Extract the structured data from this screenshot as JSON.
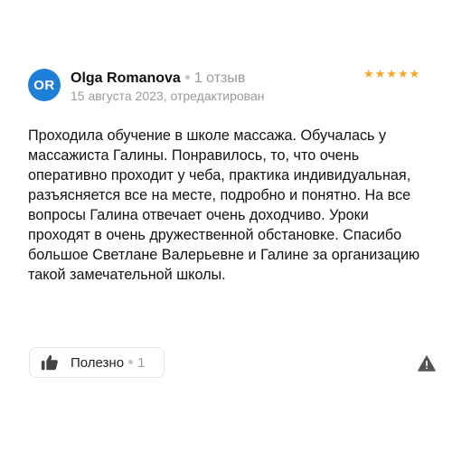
{
  "review": {
    "avatar_initials": "OR",
    "avatar_color": "#1f7fd8",
    "author_name": "Olga Romanova",
    "author_reviews": "1 отзыв",
    "date": "15 августа 2023, отредактирован",
    "rating": 5,
    "star_color": "#f5a623",
    "text": "Проходила обучение в школе массажа. Обучалась у массажиста Галины. Понравилось, то, что очень оперативно проходит у чеба, практика индивидуальная, разъясняется все на месте, подробно и понятно. На все вопросы Галина отвечает очень доходчиво. Уроки проходят в очень дружественной обстановке. Спасибо большое Светлане Валерьевне и Галине за организацию такой замечательной школы."
  },
  "actions": {
    "useful_label": "Полезно",
    "useful_count": "1",
    "thumb_icon": "thumbs-up-icon",
    "report_icon": "warning-icon"
  }
}
